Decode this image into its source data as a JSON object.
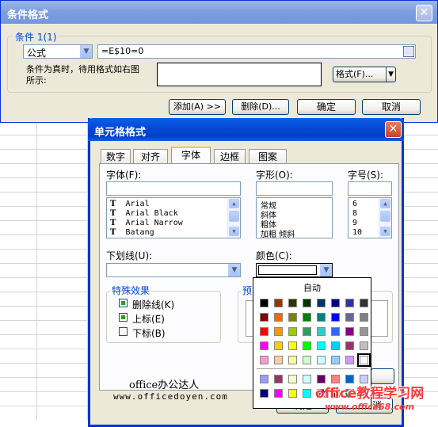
{
  "cond_dialog": {
    "title": "条件格式",
    "group_label": "条件 1(1)",
    "type_value": "公式",
    "formula_value": "=E$10=0",
    "preview_text": "条件为真时，待用格式如右图所示:",
    "format_button": "格式(F)...",
    "add_button": "添加(A) >>",
    "delete_button": "删除(D)...",
    "ok_button": "确定",
    "cancel_button": "取消"
  },
  "cell_dialog": {
    "title": "单元格格式",
    "tabs": [
      "数字",
      "对齐",
      "字体",
      "边框",
      "图案"
    ],
    "active_tab": "字体",
    "font_label": "字体(F):",
    "style_label": "字形(O):",
    "size_label": "字号(S):",
    "fonts": [
      "Arial",
      "Arial Black",
      "Arial Narrow",
      "Batang"
    ],
    "styles": [
      "常规",
      "斜体",
      "粗体",
      "加粗 倾斜"
    ],
    "sizes": [
      "6",
      "8",
      "9",
      "10"
    ],
    "underline_label": "下划线(U):",
    "color_label": "颜色(C):",
    "effects_label": "特殊效果",
    "strikethrough_label": "删除线(K)",
    "superscript_label": "上标(E)",
    "subscript_label": "下标(B)",
    "preview_label": "预览",
    "ok_button": "确定",
    "ok_button_partial": "确定",
    "cancel_partial": "消",
    "auto_color_label": "自动",
    "palette_main": [
      [
        "#000000",
        "#993300",
        "#333300",
        "#003300",
        "#003366",
        "#000080",
        "#333399",
        "#333333"
      ],
      [
        "#800000",
        "#FF6600",
        "#808000",
        "#008000",
        "#008080",
        "#0000FF",
        "#666699",
        "#808080"
      ],
      [
        "#FF0000",
        "#FF9900",
        "#99CC00",
        "#339966",
        "#33CCCC",
        "#3366FF",
        "#800080",
        "#969696"
      ],
      [
        "#FF00FF",
        "#FFCC00",
        "#FFFF00",
        "#00FF00",
        "#00FFFF",
        "#00CCFF",
        "#993366",
        "#C0C0C0"
      ],
      [
        "#FF99CC",
        "#FFCC99",
        "#FFFF99",
        "#CCFFCC",
        "#CCFFFF",
        "#99CCFF",
        "#CC99FF",
        "#FFFFFF"
      ]
    ],
    "palette_extra": [
      [
        "#9999FF",
        "#993366",
        "#FFFFCC",
        "#CCFFFF",
        "#660066",
        "#FF8080",
        "#0066CC",
        "#CCCCFF"
      ],
      [
        "#000080",
        "#FF00FF",
        "#FFFF00",
        "#00FFFF",
        "#800080",
        "#800000",
        "#008080",
        "#0000FF"
      ]
    ]
  },
  "watermark": {
    "line1": "office办公达人",
    "line2": "www.officedoyen.com",
    "brand": "office教程学习网",
    "brand_url": "www.office68.com"
  }
}
